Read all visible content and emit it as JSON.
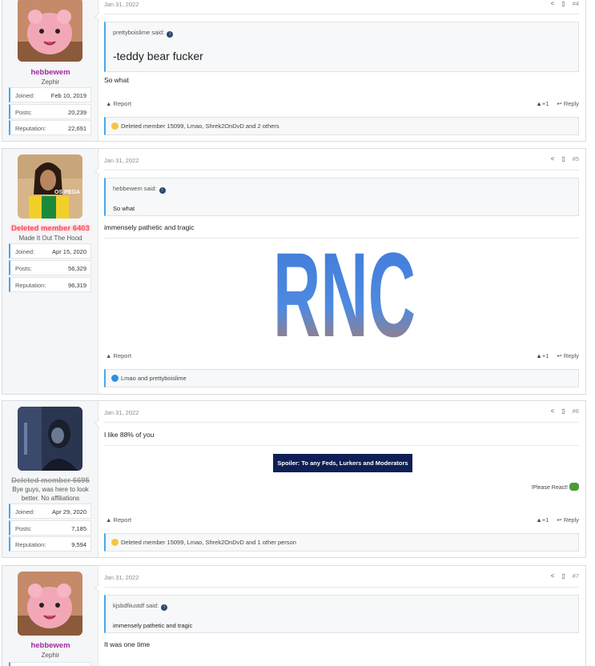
{
  "posts": [
    {
      "user": {
        "name": "hebbewem",
        "title": "Zephir",
        "joined": "Feb 10, 2019",
        "posts": "20,239",
        "reputation": "22,691"
      },
      "date": "Jan 31, 2022",
      "num": "#4",
      "quote": {
        "author": "prettyboislime said:",
        "text": "-teddy bear fucker"
      },
      "text": "So what",
      "reactions": "Deleted member 15099, Lmao, Shrek2OnDvD and 2 others"
    },
    {
      "user": {
        "name": "Deleted member 6403",
        "title": "Made It Out The Hood",
        "joined": "Apr 15, 2020",
        "posts": "56,329",
        "reputation": "96,319"
      },
      "date": "Jan 31, 2022",
      "num": "#5",
      "quote": {
        "author": "hebbewem said:",
        "text": "So what"
      },
      "text": "immensely pathetic and tragic",
      "image_text": "RNC",
      "reactions": "Lmao and prettyboislime"
    },
    {
      "user": {
        "name": "Deleted member 6695",
        "title": "Bye guys, was here to look better. No affiliations",
        "joined": "Apr 29, 2020",
        "posts": "7,185",
        "reputation": "9,594"
      },
      "date": "Jan 31, 2022",
      "num": "#6",
      "text": "I like 88% of you",
      "spoiler": "Spoiler: To any Feds, Lurkers and Moderators",
      "signature": "!Please React!",
      "reactions": "Deleted member 15099, Lmao, Shrek2OnDvD and 1 other person"
    },
    {
      "user": {
        "name": "hebbewem",
        "title": "Zephir"
      },
      "date": "Jan 31, 2022",
      "num": "#7",
      "quote": {
        "author": "kjsbdfiiustdf said:",
        "text": "immensely pathetic and tragic"
      },
      "text": "It was one time"
    }
  ],
  "labels": {
    "joined": "Joined:",
    "posts": "Posts:",
    "reputation": "Reputation:",
    "report": "Report",
    "like": "+1",
    "reply": "Reply"
  },
  "colors": {
    "accent": "#47a7eb",
    "username": "#a0279f",
    "deleted": "#ff4a5c",
    "spoiler": "#0f1f55"
  }
}
